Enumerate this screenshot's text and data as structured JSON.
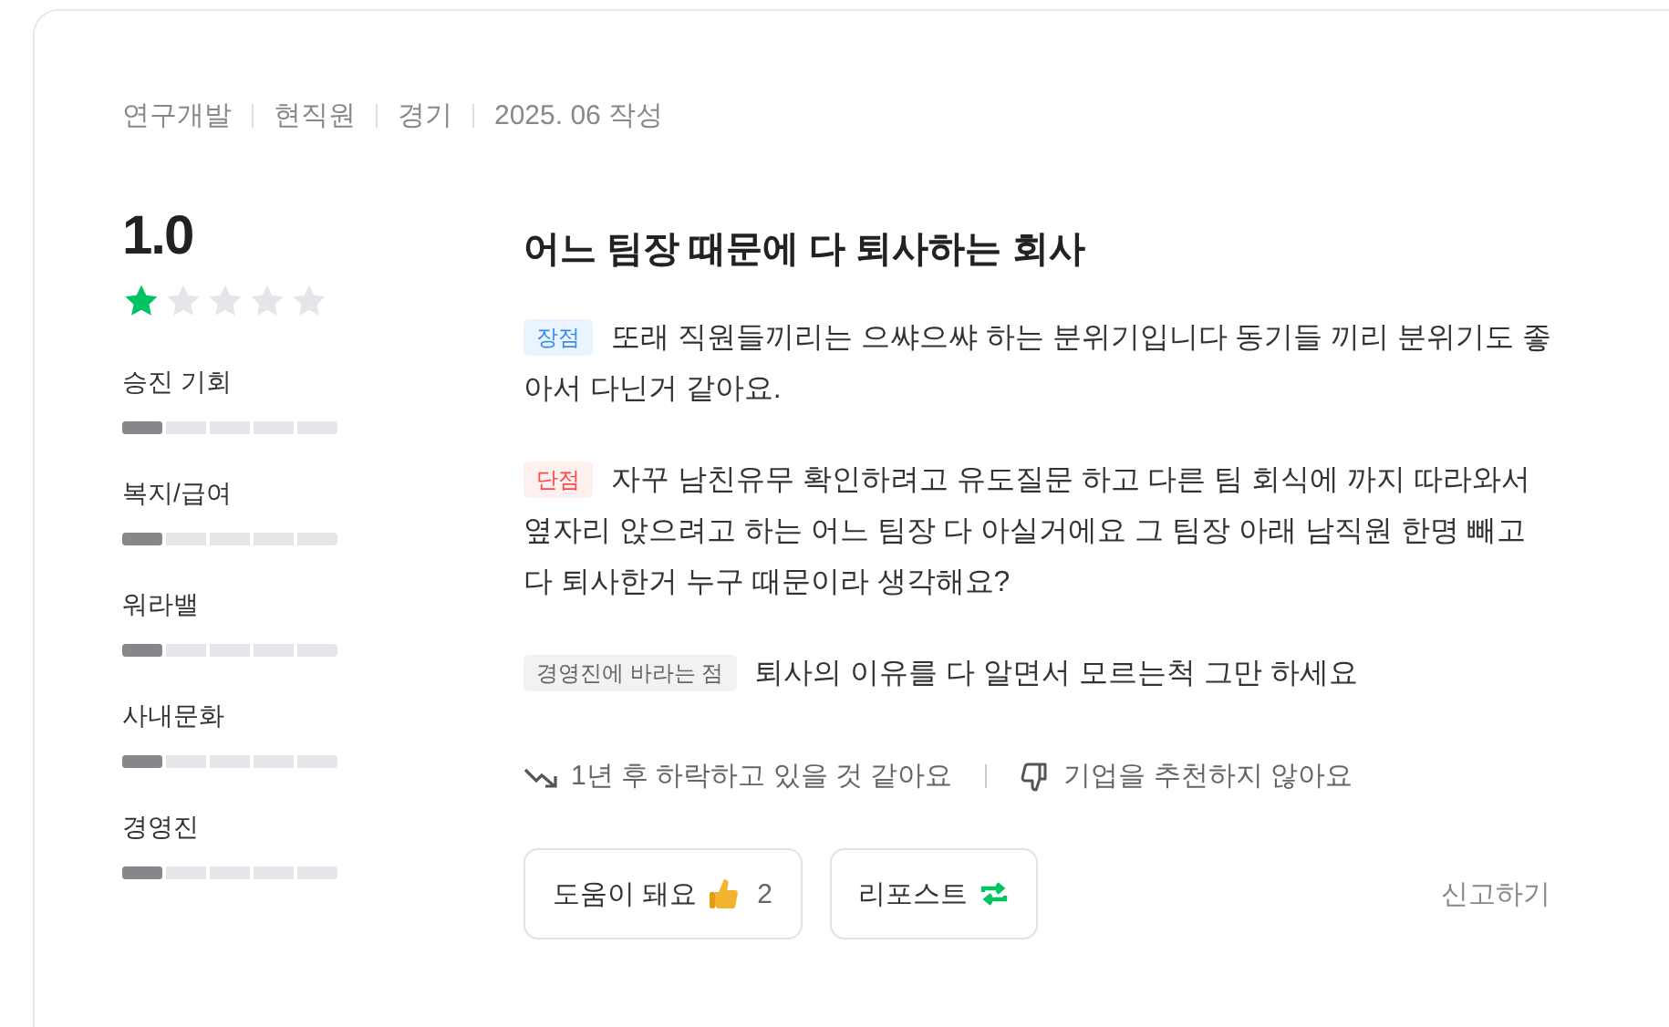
{
  "meta": [
    "연구개발",
    "현직원",
    "경기",
    "2025. 06 작성"
  ],
  "score": "1.0",
  "stars": 1,
  "ratings": [
    {
      "label": "승진 기회",
      "level": 0.2
    },
    {
      "label": "복지/급여",
      "level": 0.2
    },
    {
      "label": "워라밸",
      "level": 0.2
    },
    {
      "label": "사내문화",
      "level": 0.2
    },
    {
      "label": "경영진",
      "level": 0.2
    }
  ],
  "title": "어느 팀장 때문에 다 퇴사하는 회사",
  "sections": [
    {
      "kind": "pros",
      "tag": "장점",
      "text": "또래 직원들끼리는 으쌰으쌰 하는 분위기입니다 동기들 끼리 분위기도 좋아서 다닌거 같아요."
    },
    {
      "kind": "cons",
      "tag": "단점",
      "text": "자꾸 남친유무 확인하려고 유도질문 하고 다른 팀 회식에 까지 따라와서 옆자리 앉으려고 하는 어느 팀장 다 아실거에요 그 팀장 아래 남직원 한명 빼고 다 퇴사한거 누구 때문이라 생각해요?"
    },
    {
      "kind": "wish",
      "tag": "경영진에 바라는 점",
      "text": "퇴사의 이유를 다 알면서 모르는척 그만 하세요"
    }
  ],
  "outlook": "1년 후 하락하고 있을 것 같아요",
  "recommend": "기업을 추천하지 않아요",
  "helpful": {
    "label": "도움이 돼요",
    "count": "2"
  },
  "repost": "리포스트",
  "report": "신고하기"
}
